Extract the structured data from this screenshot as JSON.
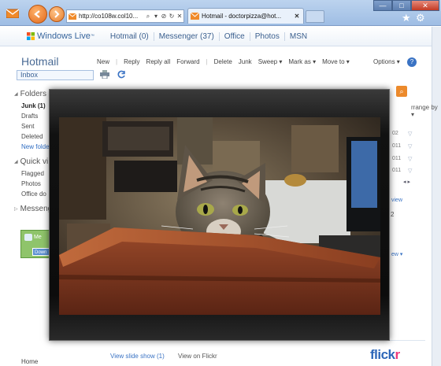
{
  "browser": {
    "address": "http://co108w.col10...",
    "address_controls": [
      "⌕",
      "▾",
      "⊘",
      "↻",
      "✕"
    ],
    "tab_title": "Hotmail - doctorpizza@hot...",
    "tab_close": "✕",
    "window_buttons": [
      "—",
      "□",
      "✕"
    ],
    "favorites_icon": "★",
    "tools_icon": "⚙"
  },
  "live_bar": {
    "logo": "Windows Live",
    "logo_tm": "™",
    "nav": [
      "Hotmail (0)",
      "Messenger (37)",
      "Office",
      "Photos",
      "MSN"
    ]
  },
  "hotmail": {
    "title": "Hotmail",
    "inbox_label": "Inbox",
    "commands": [
      "New",
      "Reply",
      "Reply all",
      "Forward",
      "Delete",
      "Junk",
      "Sweep ▾",
      "Mark as ▾",
      "Move to ▾"
    ],
    "options": "Options ▾",
    "help": "?",
    "sidebar": {
      "folders_heading": "Folders",
      "folders": [
        {
          "label": "Junk (1)",
          "style": "bold"
        },
        {
          "label": "Drafts",
          "style": "normal"
        },
        {
          "label": "Sent",
          "style": "normal"
        },
        {
          "label": "Deleted",
          "style": "normal"
        },
        {
          "label": "New folde",
          "style": "link"
        }
      ],
      "quick_heading": "Quick vi",
      "quick": [
        "Flagged",
        "Photos",
        "Office do"
      ],
      "messenger_heading": "Messeng",
      "ad_text": "Me",
      "ad_button": "Down"
    },
    "home": "Home",
    "right": {
      "arrange": "rrange by ▾",
      "dates": [
        "02",
        "011",
        "011",
        "011"
      ],
      "pager": "◂  ▸",
      "view_link": "view",
      "count": "2",
      "view2": "ew ▾"
    },
    "footer": {
      "slideshow": "View slide show (1)",
      "on_flickr": "View on Flickr",
      "flickr_a": "flick",
      "flickr_b": "r"
    }
  },
  "photo": {
    "subject": "tabby cat sitting in a wooden drawer"
  }
}
